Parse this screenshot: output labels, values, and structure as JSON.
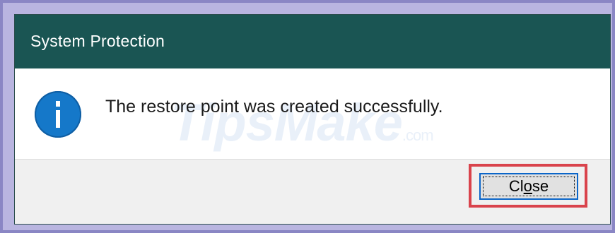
{
  "dialog": {
    "title": "System Protection",
    "message": "The restore point was created successfully.",
    "icon": "info-icon",
    "watermark": "TipsMake",
    "watermark_suffix": ".com"
  },
  "buttons": {
    "close_label": "Close",
    "close_accesskey": "o"
  },
  "colors": {
    "titlebar": "#1a5553",
    "info_icon": "#1578c9",
    "highlight": "#d9434c",
    "button_focus": "#0b66c9"
  }
}
